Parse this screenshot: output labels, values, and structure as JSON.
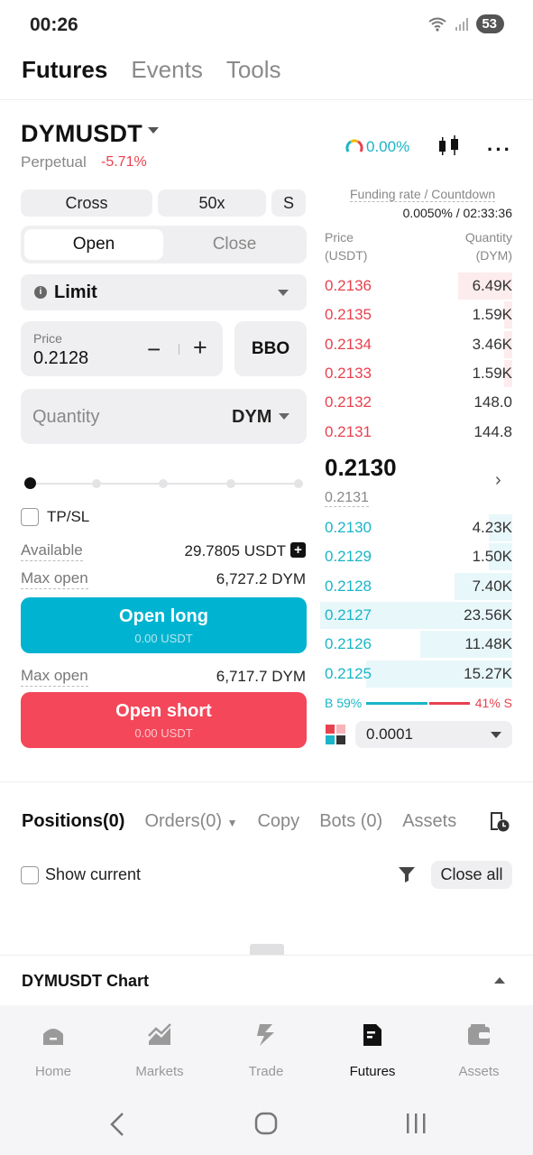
{
  "status": {
    "time": "00:26",
    "battery": "53"
  },
  "top_tabs": [
    "Futures",
    "Events",
    "Tools"
  ],
  "header": {
    "pair": "DYMUSDT",
    "type": "Perpetual",
    "change": "-5.71%",
    "gauge_pct": "0.00%"
  },
  "order_form": {
    "margin_mode": "Cross",
    "leverage": "50x",
    "side_short": "S",
    "open_label": "Open",
    "close_label": "Close",
    "order_type": "Limit",
    "price_label": "Price",
    "price_value": "0.2128",
    "bbo_label": "BBO",
    "quantity_placeholder": "Quantity",
    "quantity_unit": "DYM",
    "tpsl_label": "TP/SL",
    "available_label": "Available",
    "available_value": "29.7805 USDT",
    "max_open_label": "Max open",
    "max_open_long": "6,727.2 DYM",
    "max_open_short": "6,717.7 DYM",
    "open_long_label": "Open long",
    "open_long_sub": "0.00 USDT",
    "open_short_label": "Open short",
    "open_short_sub": "0.00 USDT"
  },
  "orderbook": {
    "funding_label": "Funding rate / Countdown",
    "funding_value": "0.0050% / 02:33:36",
    "price_header": "Price",
    "price_unit": "(USDT)",
    "qty_header": "Quantity",
    "qty_unit": "(DYM)",
    "asks": [
      {
        "price": "0.2136",
        "qty": "6.49K",
        "depth": 0.28
      },
      {
        "price": "0.2135",
        "qty": "1.59K",
        "depth": 0.04
      },
      {
        "price": "0.2134",
        "qty": "3.46K",
        "depth": 0.04
      },
      {
        "price": "0.2133",
        "qty": "1.59K",
        "depth": 0.04
      },
      {
        "price": "0.2132",
        "qty": "148.0",
        "depth": 0.0
      },
      {
        "price": "0.2131",
        "qty": "144.8",
        "depth": 0.0
      }
    ],
    "last_price": "0.2130",
    "mark_price": "0.2131",
    "bids": [
      {
        "price": "0.2130",
        "qty": "4.23K",
        "depth": 0.12
      },
      {
        "price": "0.2129",
        "qty": "1.50K",
        "depth": 0.12
      },
      {
        "price": "0.2128",
        "qty": "7.40K",
        "depth": 0.3
      },
      {
        "price": "0.2127",
        "qty": "23.56K",
        "depth": 1.0
      },
      {
        "price": "0.2126",
        "qty": "11.48K",
        "depth": 0.48
      },
      {
        "price": "0.2125",
        "qty": "15.27K",
        "depth": 0.76
      }
    ],
    "buy_ratio": "B 59%",
    "sell_ratio": "41% S",
    "precision": "0.0001"
  },
  "positions": {
    "tabs": [
      "Positions(0)",
      "Orders(0)",
      "Copy",
      "Bots (0)",
      "Assets"
    ],
    "show_current": "Show current",
    "close_all": "Close all"
  },
  "chart_bar": {
    "title": "DYMUSDT Chart"
  },
  "bottom_nav": [
    "Home",
    "Markets",
    "Trade",
    "Futures",
    "Assets"
  ]
}
